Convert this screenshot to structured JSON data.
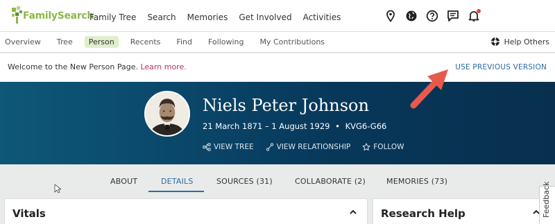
{
  "header": {
    "logo_text": "FamilySearch",
    "nav": [
      "Family Tree",
      "Search",
      "Memories",
      "Get Involved",
      "Activities"
    ],
    "icons": [
      "map-pin-icon",
      "globe-icon",
      "help-icon",
      "chat-icon",
      "bell-icon"
    ]
  },
  "subnav": {
    "items": [
      "Overview",
      "Tree",
      "Person",
      "Recents",
      "Find",
      "Following",
      "My Contributions"
    ],
    "active": "Person",
    "help_others": "Help Others"
  },
  "welcome": {
    "text": "Welcome to the New Person Page.",
    "link": "Learn more.",
    "prev_version": "USE PREVIOUS VERSION"
  },
  "person": {
    "name": "Niels Peter Johnson",
    "dates": "21 March 1871 – 1 August 1929",
    "separator": "•",
    "id": "KVG6-G66",
    "actions": {
      "view_tree": "VIEW TREE",
      "view_relationship": "VIEW RELATIONSHIP",
      "follow": "FOLLOW"
    }
  },
  "tabs": {
    "about": "ABOUT",
    "details": "DETAILS",
    "sources": "SOURCES (31)",
    "collaborate": "COLLABORATE (2)",
    "memories": "MEMORIES (73)",
    "active": "DETAILS"
  },
  "cards": {
    "vitals": "Vitals",
    "research_help": "Research Help"
  },
  "feedback": "Feedback",
  "colors": {
    "brand_green": "#8cb84a",
    "link_blue": "#2b6ba3",
    "banner_dark": "#082f4e",
    "arrow_red": "#e8594c"
  }
}
